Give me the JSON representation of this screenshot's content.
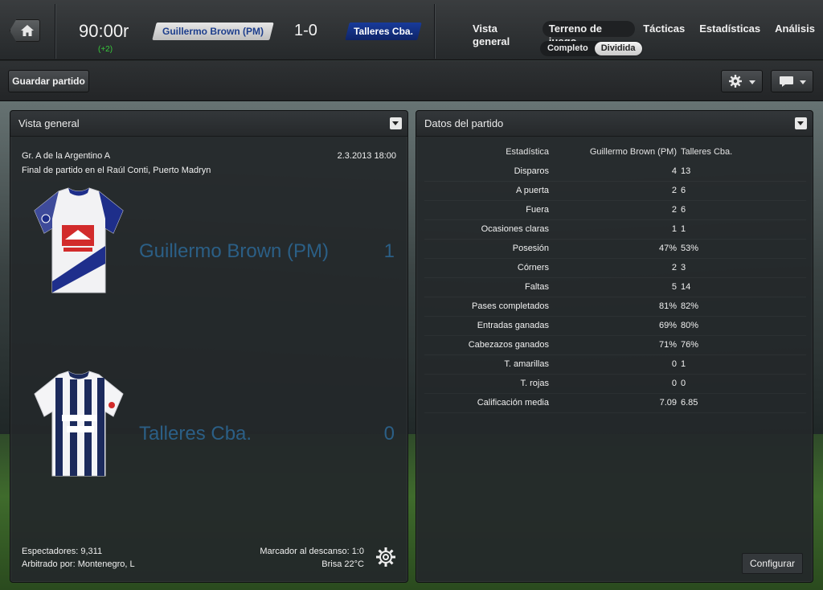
{
  "header": {
    "clock": "90:00r",
    "added_time": "(+2)",
    "home_team": "Guillermo Brown (PM)",
    "score": "1-0",
    "away_team": "Talleres Cba.",
    "nav": [
      {
        "label": "Vista general",
        "active": false
      },
      {
        "label": "Terreno de juego",
        "active": true
      },
      {
        "label": "Tácticas",
        "active": false
      },
      {
        "label": "Estadísticas",
        "active": false
      },
      {
        "label": "Análisis",
        "active": false
      }
    ],
    "subtabs": [
      {
        "label": "Completo",
        "active": false
      },
      {
        "label": "Dividida",
        "active": true
      }
    ]
  },
  "toolbar": {
    "save_label": "Guardar partido",
    "gear_icon": "gear-icon",
    "chat_icon": "chat-bubble-icon"
  },
  "overview": {
    "title": "Vista general",
    "competition": "Gr. A de la Argentino A",
    "date": "2.3.2013 18:00",
    "venue": "Final de partido en el Raúl Conti, Puerto Madryn",
    "home_team": "Guillermo Brown (PM)",
    "home_score": "1",
    "away_team": "Talleres Cba.",
    "away_score": "0",
    "spectators": "Espectadores: 9,311",
    "referee": "Arbitrado por: Montenegro, L",
    "halftime": "Marcador al descanso: 1:0",
    "weather": "Brisa 22°C",
    "colors": {
      "team_name": "#2b5f86"
    }
  },
  "match_stats": {
    "title": "Datos del partido",
    "header": {
      "stat": "Estadística",
      "home": "Guillermo Brown (PM)",
      "away": "Talleres Cba."
    },
    "rows": [
      {
        "stat": "Disparos",
        "home": "4",
        "away": "13"
      },
      {
        "stat": "A puerta",
        "home": "2",
        "away": "6"
      },
      {
        "stat": "Fuera",
        "home": "2",
        "away": "6"
      },
      {
        "stat": "Ocasiones claras",
        "home": "1",
        "away": "1"
      },
      {
        "stat": "Posesión",
        "home": "47%",
        "away": "53%"
      },
      {
        "stat": "Córners",
        "home": "2",
        "away": "3"
      },
      {
        "stat": "Faltas",
        "home": "5",
        "away": "14"
      },
      {
        "stat": "Pases completados",
        "home": "81%",
        "away": "82%"
      },
      {
        "stat": "Entradas ganadas",
        "home": "69%",
        "away": "80%"
      },
      {
        "stat": "Cabezazos ganados",
        "home": "71%",
        "away": "76%"
      },
      {
        "stat": "T. amarillas",
        "home": "0",
        "away": "1"
      },
      {
        "stat": "T. rojas",
        "home": "0",
        "away": "0"
      },
      {
        "stat": "Calificación media",
        "home": "7.09",
        "away": "6.85"
      }
    ],
    "config_label": "Configurar"
  }
}
